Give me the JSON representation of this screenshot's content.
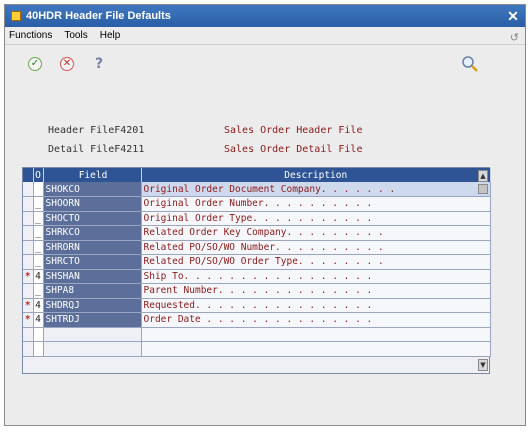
{
  "window": {
    "title": "40HDR  Header File Defaults",
    "close": "✕"
  },
  "menu": {
    "items": [
      "Functions",
      "Tools",
      "Help"
    ],
    "arrow": "↺"
  },
  "toolbar": {
    "ok_glyph": "✓",
    "cancel_glyph": "✕",
    "help_glyph": "?"
  },
  "info": {
    "header_label": "Header File",
    "header_file": "F4201",
    "header_desc": "Sales Order Header File",
    "detail_label": "Detail File",
    "detail_file": "F4211",
    "detail_desc": "Sales Order Detail File"
  },
  "grid": {
    "columns": [
      "O",
      "Field",
      "Description"
    ],
    "rows": [
      {
        "mark": "",
        "o": "",
        "field": "SHOKCO",
        "desc": "Original Order Document Company. . . . . . ."
      },
      {
        "mark": "",
        "o": "_",
        "field": "SHOORN",
        "desc": "Original Order Number. . . . . . . . . ."
      },
      {
        "mark": "",
        "o": "_",
        "field": "SHOCTO",
        "desc": "Original Order Type. . . . . . . . . . ."
      },
      {
        "mark": "",
        "o": "_",
        "field": "SHRKCO",
        "desc": "Related Order Key Company. . . . . . . . ."
      },
      {
        "mark": "",
        "o": "_",
        "field": "SHRORN",
        "desc": "Related PO/SO/WO Number. . . . . . . . . ."
      },
      {
        "mark": "",
        "o": "_",
        "field": "SHRCTO",
        "desc": "Related PO/SO/WO Order Type. . . . . . . ."
      },
      {
        "mark": "*",
        "o": "4",
        "field": "SHSHAN",
        "desc": "Ship To. . . . . . . . . . . . . . . . ."
      },
      {
        "mark": "",
        "o": "_",
        "field": "SHPA8",
        "desc": "Parent Number. . . . . . . . . . . . . ."
      },
      {
        "mark": "*",
        "o": "4",
        "field": "SHDRQJ",
        "desc": "Requested. . . . . . . . . . . . . . . ."
      },
      {
        "mark": "*",
        "o": "4",
        "field": "SHTRDJ",
        "desc": "Order Date . . . . . . . . . . . . . . ."
      }
    ]
  },
  "scroll": {
    "up": "▲",
    "down": "▼"
  },
  "colors": {
    "title_bar": "#2f5fa8",
    "grid_header": "#2f5496",
    "field_cell": "#5c6f9a",
    "desc_text": "#8b1a1a",
    "mark": "#c62828"
  }
}
